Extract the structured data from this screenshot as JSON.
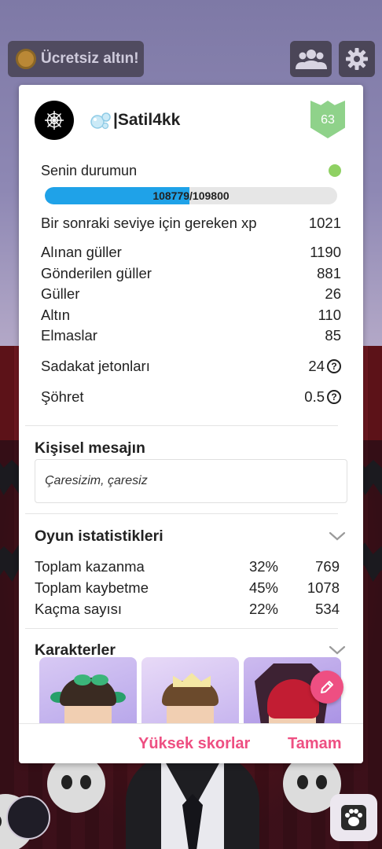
{
  "top_bar": {
    "free_gold_label": "Ücretsiz altın!",
    "icons": [
      "coin-icon",
      "friends-icon",
      "gear-icon"
    ]
  },
  "profile": {
    "username": "|Satil4kk",
    "level": "63",
    "status_label": "Senin durumun",
    "xp_text": "108779/109800",
    "xp_progress": 0.4959,
    "online_color": "#8fd163"
  },
  "stats": [
    {
      "label": "Bir sonraki seviye için gereken xp",
      "value": "1021"
    },
    {
      "label": "Alınan güller",
      "value": "1190"
    },
    {
      "label": "Gönderilen güller",
      "value": "881"
    },
    {
      "label": "Güller",
      "value": "26"
    },
    {
      "label": "Altın",
      "value": "110"
    },
    {
      "label": "Elmaslar",
      "value": "85"
    },
    {
      "label": "Sadakat jetonları",
      "value": "24"
    },
    {
      "label": "Şöhret",
      "value": "0.5"
    }
  ],
  "personal_message": {
    "title": "Kişisel mesajın",
    "text": "Çaresizim, çaresiz"
  },
  "game_stats": {
    "title": "Oyun istatistikleri",
    "rows": [
      {
        "label": "Toplam kazanma",
        "percent": "32%",
        "count": "769"
      },
      {
        "label": "Toplam kaybetme",
        "percent": "45%",
        "count": "1078"
      },
      {
        "label": "Kaçma sayısı",
        "percent": "22%",
        "count": "534"
      }
    ]
  },
  "characters": {
    "title": "Karakterler"
  },
  "footer": {
    "high_scores_label": "Yüksek skorlar",
    "ok_label": "Tamam"
  },
  "colors": {
    "accent": "#ee4f82",
    "xp_fill": "#1fa2e8",
    "level_badge": "#8fd28a"
  }
}
